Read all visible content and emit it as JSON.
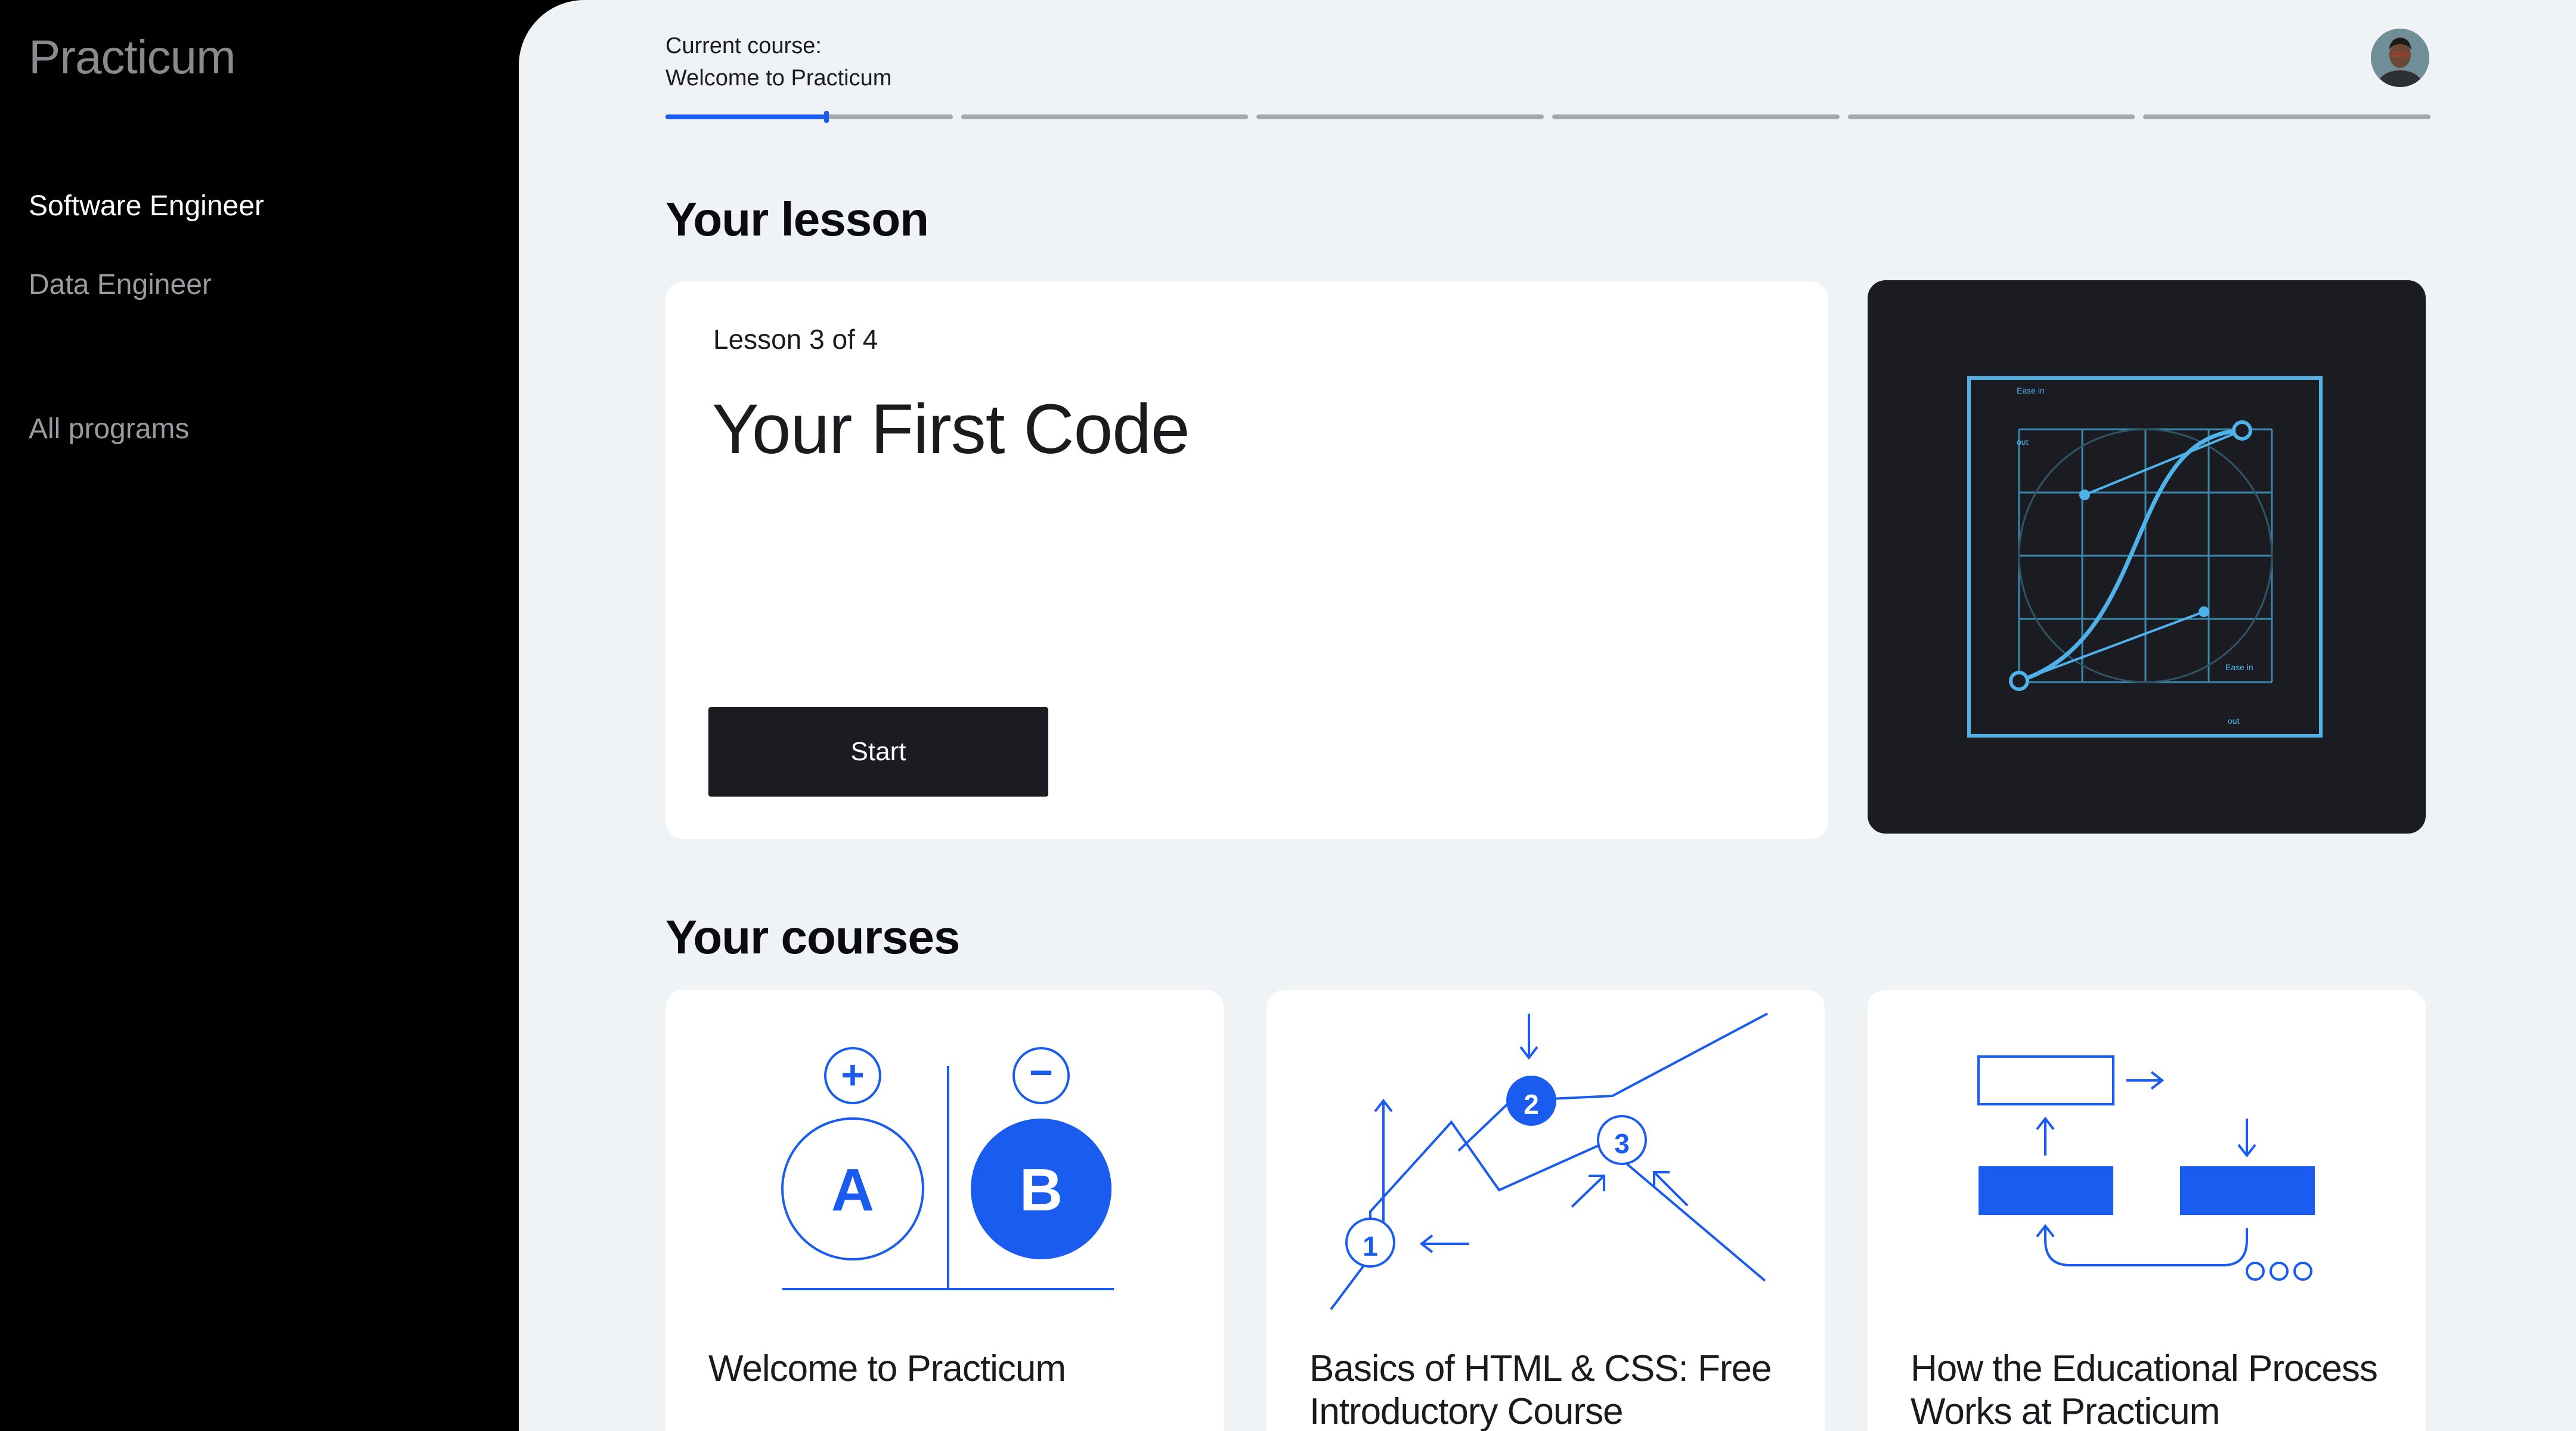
{
  "sidebar": {
    "logo": "Practicum",
    "items": [
      {
        "label": "Software Engineer",
        "active": true
      },
      {
        "label": "Data Engineer",
        "active": false
      }
    ],
    "all_programs": "All programs"
  },
  "header": {
    "current_course_label": "Current course:",
    "current_course_name": "Welcome to Practicum",
    "progress": {
      "segments": 6,
      "active_segment": 1,
      "active_fraction": 0.56
    }
  },
  "lesson": {
    "heading": "Your lesson",
    "count": "Lesson 3 of 4",
    "title": "Your First Code",
    "start_label": "Start",
    "art": {
      "ease_in": "Ease in",
      "out": "out"
    }
  },
  "courses": {
    "heading": "Your courses",
    "items": [
      {
        "title": "Welcome to Practicum",
        "art": {
          "a": "A",
          "b": "B",
          "plus": "+",
          "minus": "−"
        }
      },
      {
        "title": "Basics of HTML & CSS: Free Introductory Course",
        "art": {
          "n1": "1",
          "n2": "2",
          "n3": "3"
        }
      },
      {
        "title": "How the Educational Process Works at Practicum"
      }
    ]
  },
  "colors": {
    "accent": "#1a5bf0",
    "dark": "#1b1c22",
    "curve": "#4fb3ea",
    "page_bg": "#eff3f6"
  }
}
